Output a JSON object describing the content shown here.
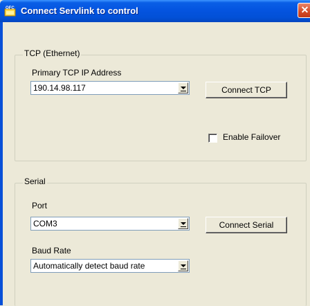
{
  "window": {
    "title": "Connect Servlink to control",
    "close_glyph": "✕",
    "app_icon": "ofc-app-icon"
  },
  "tcp": {
    "group_label": "TCP (Ethernet)",
    "address_label": "Primary TCP IP Address",
    "address_value": "190.14.98.117",
    "connect_label": "Connect TCP",
    "failover_label": "Enable Failover",
    "failover_checked": false
  },
  "serial": {
    "group_label": "Serial",
    "port_label": "Port",
    "port_value": "COM3",
    "connect_label": "Connect Serial",
    "baud_label": "Baud Rate",
    "baud_value": "Automatically detect baud rate"
  },
  "colors": {
    "titlebar": "#0454e0",
    "dialog_bg": "#ece9d8",
    "close": "#d44a25"
  }
}
